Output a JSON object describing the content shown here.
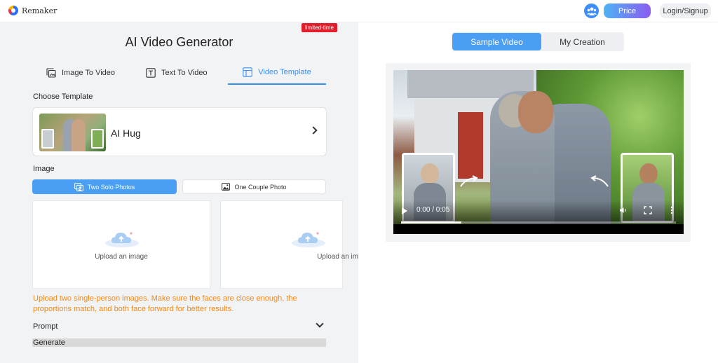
{
  "header": {
    "logo_text": "Remaker",
    "price_label": "Price",
    "login_label": "Login/Signup"
  },
  "left": {
    "title": "AI Video Generator",
    "badge": "limited-time",
    "tabs": [
      {
        "label": "Image To Video",
        "icon": "image-stack-icon"
      },
      {
        "label": "Text To Video",
        "icon": "text-box-icon"
      },
      {
        "label": "Video Template",
        "icon": "template-layout-icon",
        "active": true
      }
    ],
    "choose_template_label": "Choose Template",
    "template": {
      "name": "AI Hug"
    },
    "image_label": "Image",
    "modes": [
      {
        "label": "Two Solo Photos",
        "active": true
      },
      {
        "label": "One Couple Photo",
        "active": false
      }
    ],
    "upload_label_1": "Upload an image",
    "upload_label_2": "Upload an image",
    "hint": "Upload two single-person images. Make sure the faces are close enough, the proportions match, and both face forward for better results.",
    "prompt_label": "Prompt",
    "generate_label": "Generate"
  },
  "right": {
    "toggle": [
      {
        "label": "Sample Video",
        "active": true
      },
      {
        "label": "My Creation",
        "active": false
      }
    ],
    "video": {
      "time": "0:00 / 0:05",
      "progress": 0.22
    }
  },
  "colors": {
    "accent": "#4a9ff5",
    "badge": "#e11e2b",
    "hint": "#f08a1c"
  }
}
